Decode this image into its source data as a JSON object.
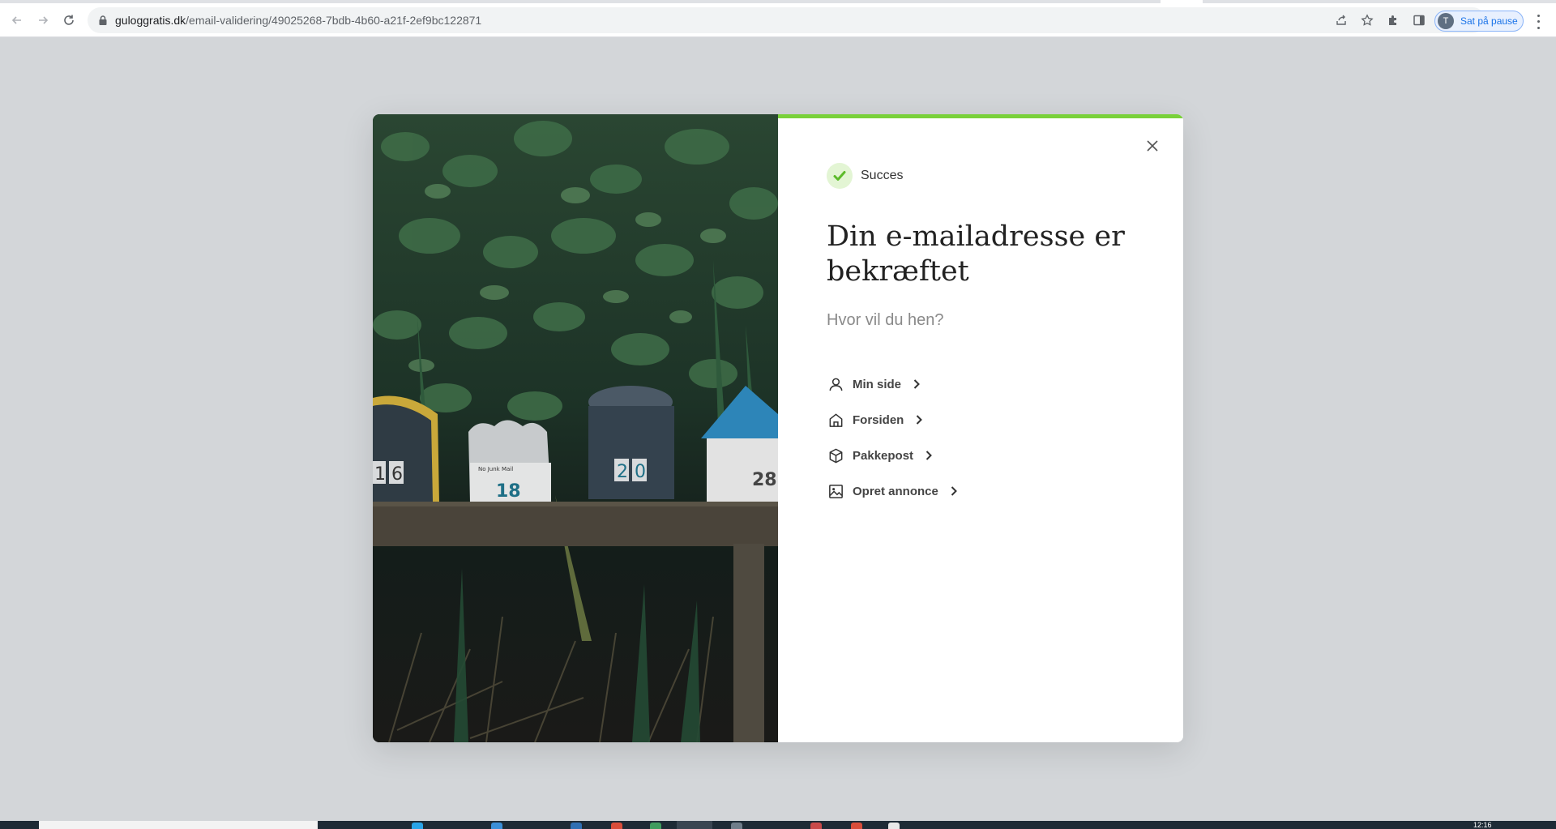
{
  "browser": {
    "url_host": "guloggratis.dk",
    "url_path": "/email-validering/49025268-7bdb-4b60-a21f-2ef9bc122871",
    "profile_initial": "T",
    "profile_label": "Sat på pause"
  },
  "modal": {
    "status_label": "Succes",
    "heading": "Din e-mailadresse er bekræftet",
    "subheading": "Hvor vil du hen?",
    "links": [
      {
        "label": "Min side",
        "icon": "user-icon"
      },
      {
        "label": "Forsiden",
        "icon": "home-icon"
      },
      {
        "label": "Pakkepost",
        "icon": "package-icon"
      },
      {
        "label": "Opret annonce",
        "icon": "image-icon"
      }
    ],
    "photo": {
      "mailbox_numbers": [
        "1 6",
        "18",
        "2 0",
        "28"
      ],
      "mailbox_sign": "No Junk Mail"
    },
    "progress_fraction": 1.0
  },
  "colors": {
    "accent_green": "#79d13a",
    "status_bg": "#e3f5d4",
    "page_background": "#d3d6d9",
    "profile_blue": "#1a73e8"
  },
  "taskbar": {
    "clock": "12:16"
  }
}
